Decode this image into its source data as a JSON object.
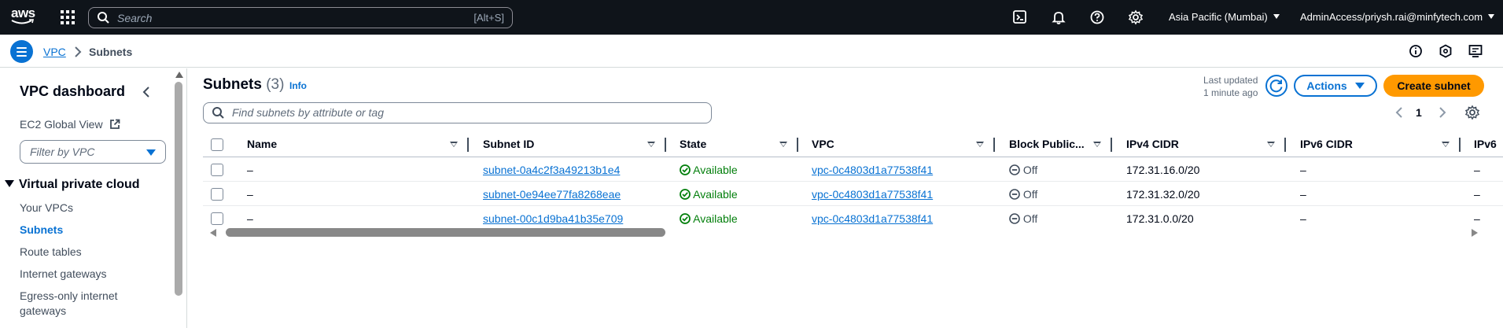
{
  "topbar": {
    "logo_text": "aws",
    "search_placeholder": "Search",
    "search_shortcut": "[Alt+S]",
    "icons": [
      "cloudshell-icon",
      "bell-icon",
      "help-icon",
      "gear-icon"
    ],
    "region": "Asia Pacific (Mumbai)",
    "account": "AdminAccess/priysh.rai@minfytech.com"
  },
  "breadcrumb": {
    "parent": "VPC",
    "current": "Subnets"
  },
  "sidebar": {
    "title": "VPC dashboard",
    "ec2_link": "EC2 Global View",
    "filter_placeholder": "Filter by VPC",
    "section": "Virtual private cloud",
    "items": [
      {
        "label": "Your VPCs"
      },
      {
        "label": "Subnets"
      },
      {
        "label": "Route tables"
      },
      {
        "label": "Internet gateways"
      },
      {
        "label": "Egress-only internet gateways"
      }
    ]
  },
  "panel": {
    "title": "Subnets",
    "count": "(3)",
    "info": "Info",
    "last_updated_line1": "Last updated",
    "last_updated_line2": "1 minute ago",
    "actions_label": "Actions",
    "create_label": "Create subnet",
    "filter_placeholder": "Find subnets by attribute or tag",
    "page": "1"
  },
  "table": {
    "columns": [
      "Name",
      "Subnet ID",
      "State",
      "VPC",
      "Block Public...",
      "IPv4 CIDR",
      "IPv6 CIDR",
      "IPv6"
    ],
    "rows": [
      {
        "name": "–",
        "subnet_id": "subnet-0a4c2f3a49213b1e4",
        "state": "Available",
        "vpc": "vpc-0c4803d1a77538f41",
        "block": "Off",
        "ipv4": "172.31.16.0/20",
        "ipv6": "–",
        "ipv6b": "–"
      },
      {
        "name": "–",
        "subnet_id": "subnet-0e94ee77fa8268eae",
        "state": "Available",
        "vpc": "vpc-0c4803d1a77538f41",
        "block": "Off",
        "ipv4": "172.31.32.0/20",
        "ipv6": "–",
        "ipv6b": "–"
      },
      {
        "name": "–",
        "subnet_id": "subnet-00c1d9ba41b35e709",
        "state": "Available",
        "vpc": "vpc-0c4803d1a77538f41",
        "block": "Off",
        "ipv4": "172.31.0.0/20",
        "ipv6": "–",
        "ipv6b": "–"
      }
    ]
  },
  "colors": {
    "accent": "#0972d3",
    "primary_button": "#ff9900",
    "success": "#037f0c",
    "topbar_bg": "#0f141a"
  }
}
